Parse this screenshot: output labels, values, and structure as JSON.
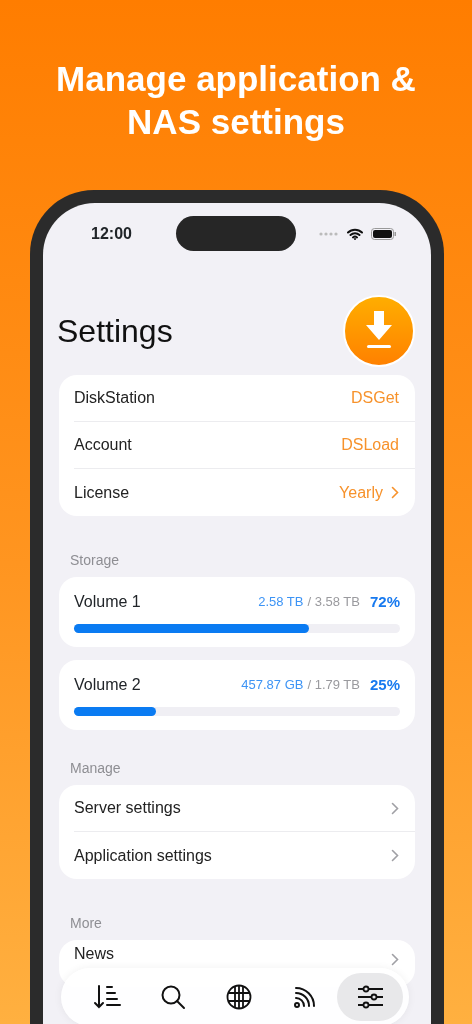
{
  "headline": "Manage application & NAS settings",
  "status_bar": {
    "time": "12:00"
  },
  "title": "Settings",
  "account_rows": [
    {
      "label": "DiskStation",
      "value": "DSGet",
      "chevron": false
    },
    {
      "label": "Account",
      "value": "DSLoad",
      "chevron": false
    },
    {
      "label": "License",
      "value": "Yearly",
      "chevron": true
    }
  ],
  "storage": {
    "header": "Storage",
    "volumes": [
      {
        "name": "Volume 1",
        "used": "2.58 TB",
        "total": "/ 3.58 TB",
        "percent": "72%",
        "level": 0.72
      },
      {
        "name": "Volume 2",
        "used": "457.87 GB",
        "total": "/ 1.79 TB",
        "percent": "25%",
        "level": 0.25
      }
    ]
  },
  "manage": {
    "header": "Manage",
    "items": [
      "Server settings",
      "Application settings"
    ]
  },
  "more": {
    "header": "More",
    "items": [
      "News"
    ]
  },
  "tab_bar": [
    {
      "kind": "transfers",
      "selected": false
    },
    {
      "kind": "search",
      "selected": false
    },
    {
      "kind": "browser",
      "selected": false
    },
    {
      "kind": "feeds",
      "selected": false
    },
    {
      "kind": "settings",
      "selected": true
    }
  ]
}
